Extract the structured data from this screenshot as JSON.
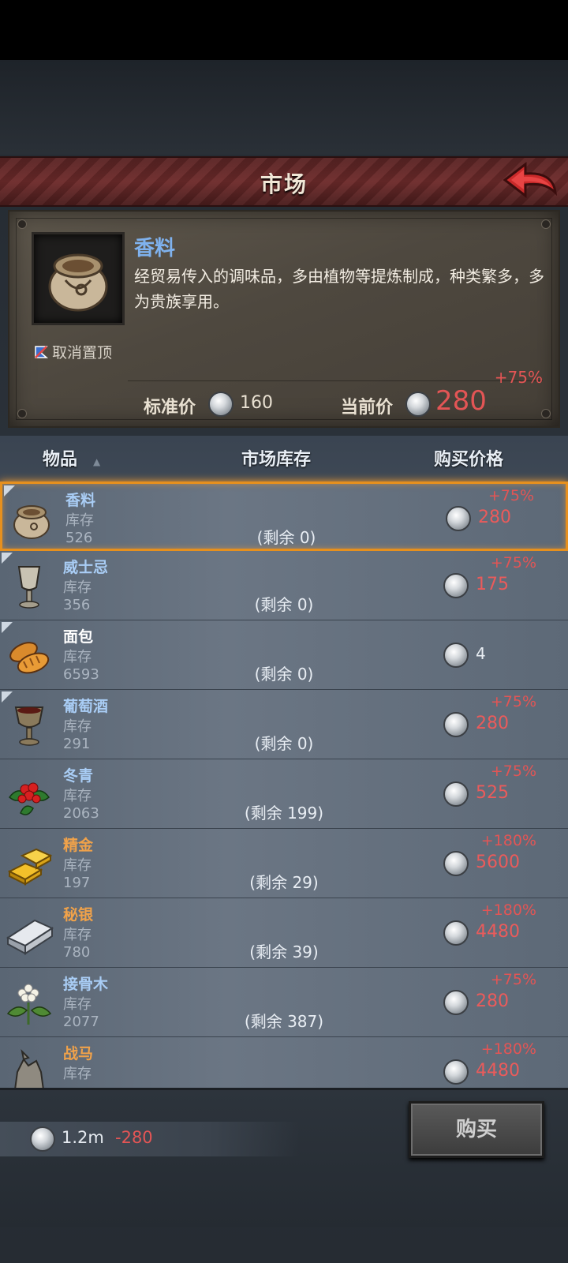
{
  "header": {
    "title": "市场"
  },
  "info": {
    "name": "香料",
    "description": "经贸易传入的调味品，多由植物等提炼制成，种类繁多，多为贵族享用。",
    "unpin_label": "取消置顶",
    "std_price_label": "标准价",
    "std_price": "160",
    "cur_price_label": "当前价",
    "cur_price": "280",
    "cur_price_pct": "+75%"
  },
  "columns": {
    "item": "物品",
    "stock": "市场库存",
    "price": "购买价格"
  },
  "stock_label": "库存",
  "items": [
    {
      "name": "香料",
      "stock": "526",
      "remain": "(剩余 0)",
      "pct": "+75%",
      "price": "280",
      "icon": "spice-bag-icon"
    },
    {
      "name": "威士忌",
      "stock": "356",
      "remain": "(剩余 0)",
      "pct": "+75%",
      "price": "175",
      "icon": "goblet-icon"
    },
    {
      "name": "面包",
      "stock": "6593",
      "remain": "(剩余 0)",
      "pct": "",
      "price": "4",
      "icon": "bread-icon"
    },
    {
      "name": "葡萄酒",
      "stock": "291",
      "remain": "(剩余 0)",
      "pct": "+75%",
      "price": "280",
      "icon": "wine-goblet-icon"
    },
    {
      "name": "冬青",
      "stock": "2063",
      "remain": "(剩余 199)",
      "pct": "+75%",
      "price": "525",
      "icon": "holly-icon"
    },
    {
      "name": "精金",
      "stock": "197",
      "remain": "(剩余 29)",
      "pct": "+180%",
      "price": "5600",
      "icon": "gold-bar-icon"
    },
    {
      "name": "秘银",
      "stock": "780",
      "remain": "(剩余 39)",
      "pct": "+180%",
      "price": "4480",
      "icon": "silver-ingot-icon"
    },
    {
      "name": "接骨木",
      "stock": "2077",
      "remain": "(剩余 387)",
      "pct": "+75%",
      "price": "280",
      "icon": "elder-flower-icon"
    },
    {
      "name": "战马",
      "stock": "",
      "remain": "",
      "pct": "+180%",
      "price": "4480",
      "icon": "warhorse-icon"
    }
  ],
  "wallet": {
    "balance": "1.2m",
    "delta": "-280"
  },
  "buy_label": "购买",
  "colors": {
    "accent_red": "#e35555",
    "name_blue": "#a9cdf5",
    "name_orange": "#f0a24a",
    "selection": "#e6901e"
  }
}
